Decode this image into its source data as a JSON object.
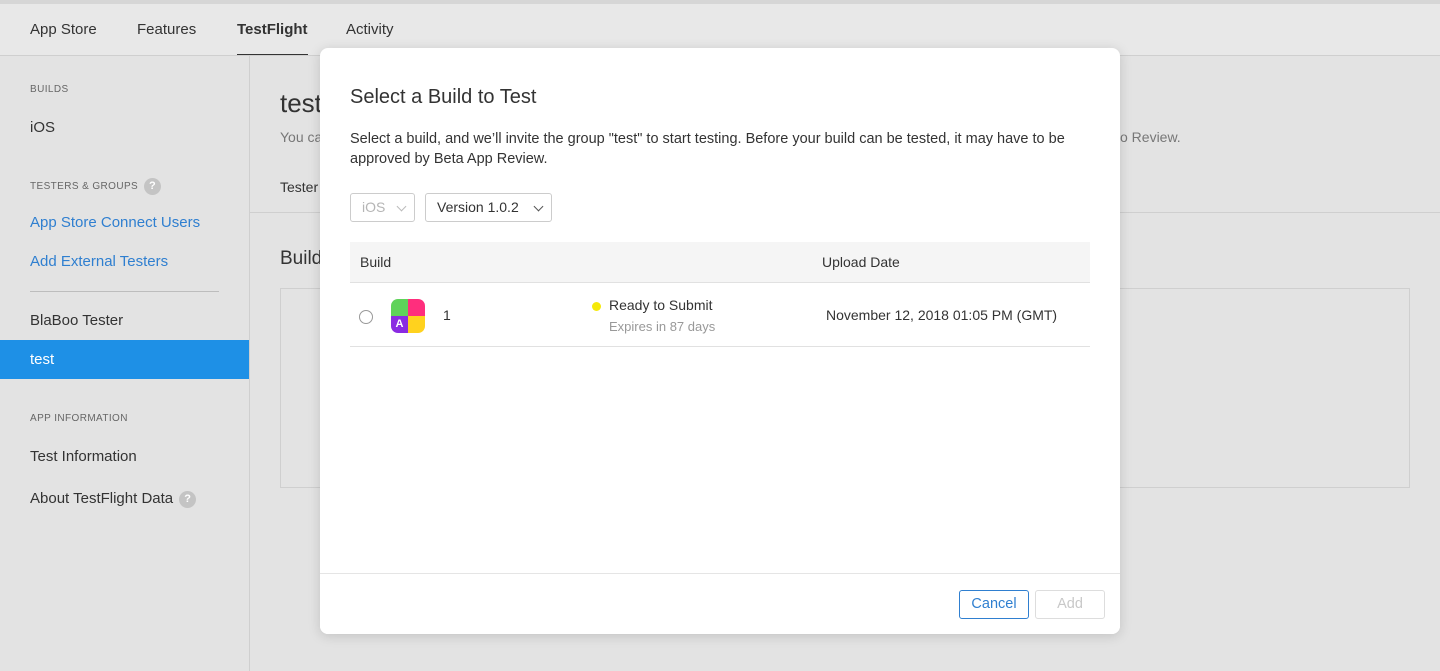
{
  "topnav": {
    "tabs": [
      {
        "label": "App Store"
      },
      {
        "label": "Features"
      },
      {
        "label": "TestFlight"
      },
      {
        "label": "Activity"
      }
    ]
  },
  "sidebar": {
    "builds_heading": "BUILDS",
    "ios": "iOS",
    "testers_heading": "TESTERS & GROUPS",
    "help_symbol": "?",
    "connect_users": "App Store Connect Users",
    "add_external": "Add External Testers",
    "group_blaboo": "BlaBoo Tester",
    "group_test": "test",
    "app_info_heading": "APP INFORMATION",
    "test_information": "Test Information",
    "about_data": "About TestFlight Data"
  },
  "background": {
    "title": "test",
    "desc_left": "You ca",
    "desc_right": "o Review.",
    "testers_tab": "Tester",
    "builds_heading": "Build"
  },
  "modal": {
    "title": "Select a Build to Test",
    "description": "Select a build, and we’ll invite the group \"test\" to start testing. Before your build can be tested, it may have to be approved by Beta App Review.",
    "platform_select": "iOS",
    "version_select": "Version 1.0.2",
    "table": {
      "col_build": "Build",
      "col_upload": "Upload Date",
      "rows": [
        {
          "build": "1",
          "status": "Ready to Submit",
          "expires": "Expires in 87 days",
          "upload_date": "November 12, 2018 01:05 PM (GMT)",
          "icon_letter": "A"
        }
      ]
    },
    "cancel": "Cancel",
    "add": "Add"
  },
  "colors": {
    "accent": "#1e90e6",
    "link": "#2f7fd0",
    "status_ready": "#f5e90a"
  }
}
